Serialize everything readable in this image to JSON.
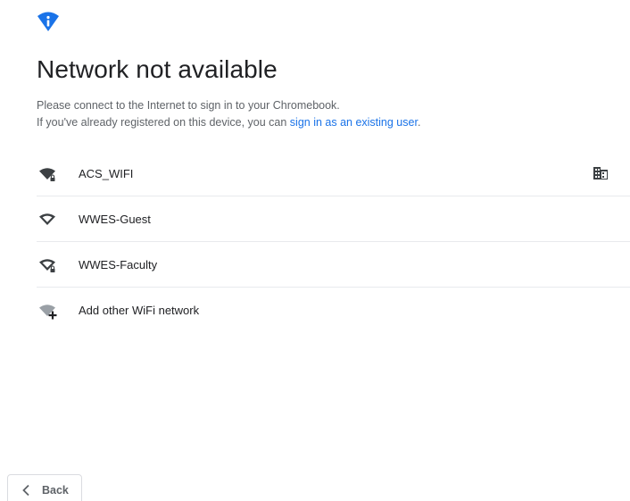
{
  "header": {
    "icon": "wifi-info-icon",
    "accent_color": "#1a73e8",
    "title": "Network not available"
  },
  "message": {
    "line1": "Please connect to the Internet to sign in to your Chromebook.",
    "line2_prefix": "If you've already registered on this device, you can ",
    "line2_link": "sign in as an existing user",
    "line2_suffix": "."
  },
  "networks": [
    {
      "name": "ACS_WIFI",
      "icon": "wifi-secured-icon",
      "managed": true,
      "managed_icon": "enterprise-building-icon"
    },
    {
      "name": "WWES-Guest",
      "icon": "wifi-icon",
      "managed": false
    },
    {
      "name": "WWES-Faculty",
      "icon": "wifi-secured-icon",
      "managed": false
    },
    {
      "name": "Add other WiFi network",
      "icon": "wifi-add-icon",
      "managed": false
    }
  ],
  "footer": {
    "back_label": "Back",
    "back_icon": "chevron-left-icon"
  }
}
